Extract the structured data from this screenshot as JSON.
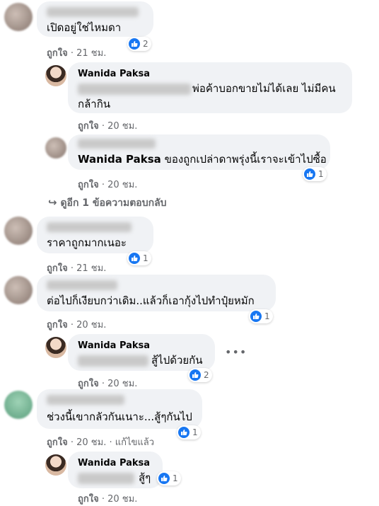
{
  "comments": [
    {
      "text": "เปิดอยู่ใช่ไหมดา",
      "like_label": "ถูกใจ",
      "time": "21 ชม.",
      "reactions": "2"
    },
    {
      "name": "Wanida Paksa",
      "text_line1": "พ่อค้าบอกขายไม่ได้เลย ไม่มีคน",
      "text_line2": "กล้ากิน",
      "like_label": "ถูกใจ",
      "time": "20 ชม."
    },
    {
      "mention": "Wanida Paksa",
      "text": "ของถูกเปล่าดาพรุ่งนี้เราจะเข้าไปซื้อ",
      "like_label": "ถูกใจ",
      "time": "20 ชม.",
      "reactions": "1"
    },
    {
      "more_replies": "ดูอีก 1 ข้อความตอบกลับ"
    },
    {
      "text": "ราคาถูกมากเนอะ",
      "like_label": "ถูกใจ",
      "time": "21 ชม.",
      "reactions": "1"
    },
    {
      "text": "ต่อไปก็เงียบกว่าเดิม..แล้วก็เอากุ้งไปทำปุ๋ยหมัก",
      "like_label": "ถูกใจ",
      "time": "20 ชม.",
      "reactions": "1"
    },
    {
      "name": "Wanida Paksa",
      "text": "สู้ไปด้วยกัน",
      "like_label": "ถูกใจ",
      "time": "20 ชม.",
      "reactions": "2"
    },
    {
      "text": "ช่วงนี้เขากลัวกันเนาะ...สู้ๆกันไป",
      "like_label": "ถูกใจ",
      "time": "20 ชม.",
      "edited": "แก้ไขแล้ว",
      "reactions": "1"
    },
    {
      "name": "Wanida Paksa",
      "text": "สู้ๆ",
      "like_label": "ถูกใจ",
      "time": "20 ชม.",
      "reactions": "1"
    }
  ],
  "icons": {
    "like": "thumbs-up-icon",
    "reply_arrow": "reply-arrow-icon",
    "more": "more-options-icon"
  },
  "colors": {
    "accent": "#1877f2",
    "bubble": "#f0f2f5",
    "meta": "#65676b"
  }
}
